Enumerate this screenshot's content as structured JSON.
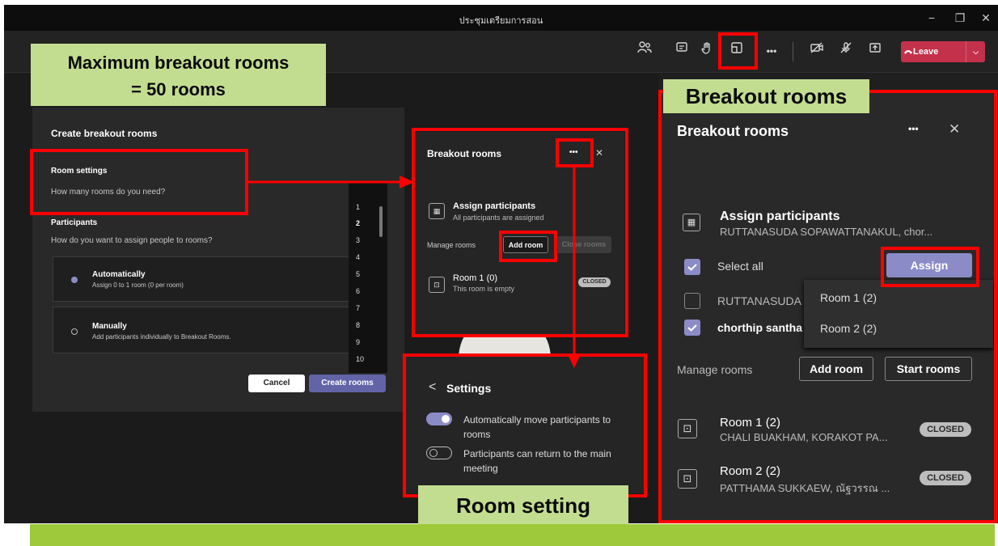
{
  "window": {
    "title": "ประชุมเตรียมการสอน",
    "controls": [
      "−",
      "❐",
      "✕"
    ]
  },
  "toolbar": {
    "icons": [
      "people-icon",
      "chat-icon",
      "raise-hand-icon",
      "breakout-rooms-icon",
      "more-icon",
      "camera-off-icon",
      "mic-off-icon",
      "share-icon"
    ],
    "more_glyph": "•••",
    "leave_label": "Leave",
    "leave_menu_glyph": "⌵"
  },
  "annotations": {
    "max_rooms_line1": "Maximum breakout rooms",
    "max_rooms_line2": "= 50 rooms",
    "breakout_rooms": "Breakout rooms",
    "room_setting": "Room setting"
  },
  "create_dialog": {
    "title": "Create breakout rooms",
    "room_settings_heading": "Room settings",
    "room_settings_question": "How many rooms do you need?",
    "selected_count": "1",
    "participants_heading": "Participants",
    "participants_question": "How do you want to assign people to rooms?",
    "auto_title": "Automatically",
    "auto_desc": "Assign 0 to 1 room (0 per room)",
    "manual_title": "Manually",
    "manual_desc": "Add participants individually to Breakout Rooms.",
    "numbers": [
      "1",
      "2",
      "3",
      "4",
      "5",
      "6",
      "7",
      "8",
      "9",
      "10"
    ],
    "cancel_label": "Cancel",
    "create_label": "Create rooms"
  },
  "small_panel": {
    "title": "Breakout rooms",
    "more_glyph": "•••",
    "close_glyph": "✕",
    "assign_title": "Assign participants",
    "assign_subtitle": "All participants are assigned",
    "manage_label": "Manage rooms",
    "add_room_label": "Add room",
    "close_rooms_label": "Close rooms",
    "room_name": "Room 1 (0)",
    "room_subtitle": "This room is empty",
    "room_status": "CLOSED"
  },
  "settings_panel": {
    "back_glyph": "<",
    "title": "Settings",
    "option1_line1": "Automatically move participants to",
    "option1_line2": "rooms",
    "option1_enabled": true,
    "option2_line1": "Participants can return to the main",
    "option2_line2": "meeting",
    "option2_enabled": false
  },
  "big_panel": {
    "title": "Breakout rooms",
    "more_glyph": "•••",
    "close_glyph": "✕",
    "assign_title": "Assign participants",
    "assign_subtitle": "RUTTANASUDA SOPAWATTANAKUL, chor...",
    "select_all_label": "Select all",
    "assign_button": "Assign",
    "participant1": "RUTTANASUDA",
    "participant2": "chorthip santha",
    "manage_label": "Manage rooms",
    "add_room_label": "Add room",
    "start_rooms_label": "Start rooms",
    "room1_name": "Room 1 (2)",
    "room1_members": "CHALI BUAKHAM, KORAKOT PA...",
    "room1_status": "CLOSED",
    "room2_name": "Room 2 (2)",
    "room2_members": "PATTHAMA SUKKAEW, ณัฐวรรณ ...",
    "room2_status": "CLOSED"
  },
  "room_menu": {
    "items": [
      "Room 1 (2)",
      "Room 2 (2)"
    ]
  },
  "colors": {
    "accent": "#8b8cc7",
    "leave": "#c4314b",
    "highlight": "#ff0000",
    "label_bg": "#c3dd90",
    "bottom_band": "#9dc93a"
  }
}
